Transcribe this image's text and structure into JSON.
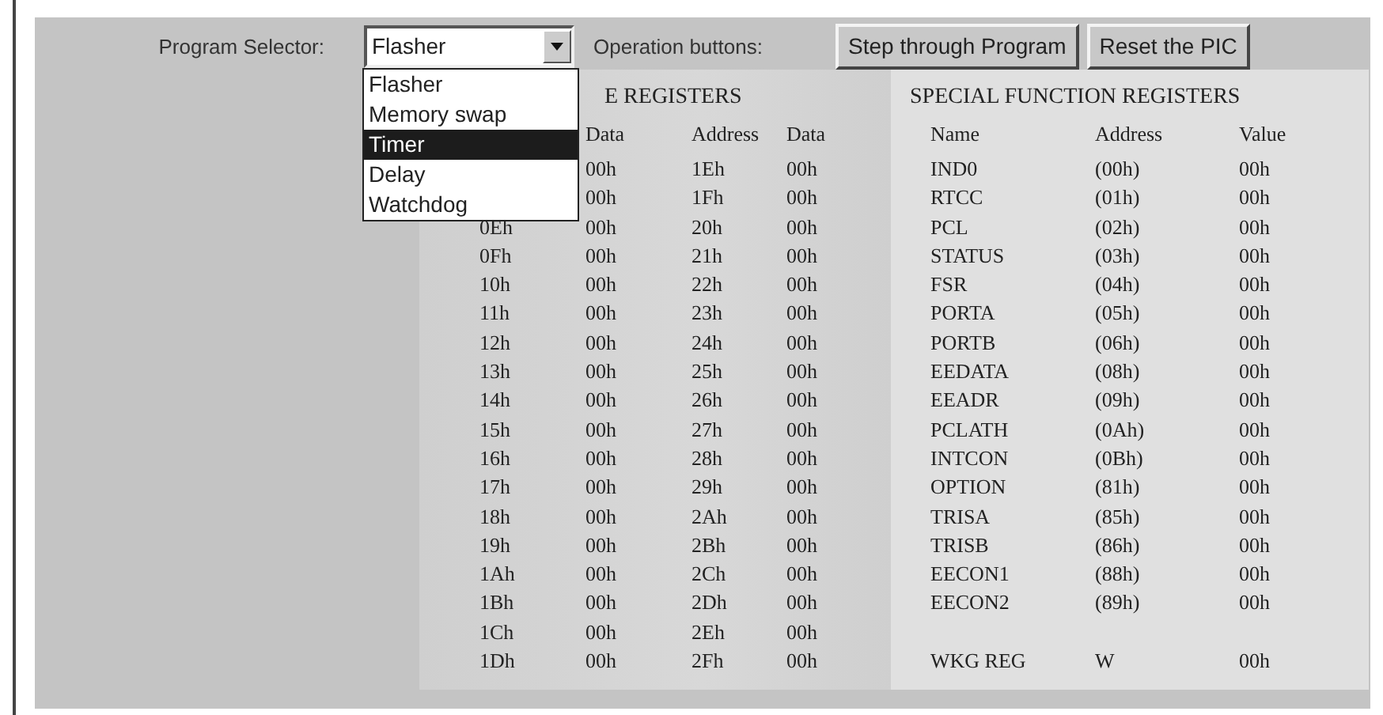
{
  "program_selector": {
    "label": "Program Selector:",
    "value": "Flasher",
    "expanded": true,
    "options": [
      {
        "label": "Flasher",
        "highlighted": false
      },
      {
        "label": "Memory swap",
        "highlighted": false
      },
      {
        "label": "Timer",
        "highlighted": true
      },
      {
        "label": "Delay",
        "highlighted": false
      },
      {
        "label": "Watchdog",
        "highlighted": false
      }
    ]
  },
  "operation_label": "Operation buttons:",
  "buttons": [
    "Step through Program",
    "Reset the PIC"
  ],
  "file_registers": {
    "title": "E REGISTERS",
    "columns": [
      "Data",
      "Address",
      "Data"
    ],
    "rows": [
      {
        "data": "00h",
        "address_2": "1Eh",
        "data_2": "00h"
      },
      {
        "data": "00h",
        "address_2": "1Fh",
        "data_2": "00h"
      },
      {
        "address": "0Eh",
        "data": "00h",
        "address_2": "20h",
        "data_2": "00h"
      },
      {
        "address": "0Fh",
        "data": "00h",
        "address_2": "21h",
        "data_2": "00h"
      },
      {
        "address": "10h",
        "data": "00h",
        "address_2": "22h",
        "data_2": "00h"
      },
      {
        "address": "11h",
        "data": "00h",
        "address_2": "23h",
        "data_2": "00h"
      },
      {
        "address": "12h",
        "data": "00h",
        "address_2": "24h",
        "data_2": "00h"
      },
      {
        "address": "13h",
        "data": "00h",
        "address_2": "25h",
        "data_2": "00h"
      },
      {
        "address": "14h",
        "data": "00h",
        "address_2": "26h",
        "data_2": "00h"
      },
      {
        "address": "15h",
        "data": "00h",
        "address_2": "27h",
        "data_2": "00h"
      },
      {
        "address": "16h",
        "data": "00h",
        "address_2": "28h",
        "data_2": "00h"
      },
      {
        "address": "17h",
        "data": "00h",
        "address_2": "29h",
        "data_2": "00h"
      },
      {
        "address": "18h",
        "data": "00h",
        "address_2": "2Ah",
        "data_2": "00h"
      },
      {
        "address": "19h",
        "data": "00h",
        "address_2": "2Bh",
        "data_2": "00h"
      },
      {
        "address": "1Ah",
        "data": "00h",
        "address_2": "2Ch",
        "data_2": "00h"
      },
      {
        "address": "1Bh",
        "data": "00h",
        "address_2": "2Dh",
        "data_2": "00h"
      },
      {
        "address": "1Ch",
        "data": "00h",
        "address_2": "2Eh",
        "data_2": "00h"
      },
      {
        "address": "1Dh",
        "data": "00h",
        "address_2": "2Fh",
        "data_2": "00h"
      }
    ]
  },
  "special_function_registers": {
    "title": "SPECIAL FUNCTION REGISTERS",
    "columns": [
      "Name",
      "Address",
      "Value"
    ],
    "rows": [
      {
        "name": "IND0",
        "address": "(00h)",
        "value": "00h"
      },
      {
        "name": "RTCC",
        "address": "(01h)",
        "value": "00h"
      },
      {
        "name": "PCL",
        "address": "(02h)",
        "value": "00h"
      },
      {
        "name": "STATUS",
        "address": "(03h)",
        "value": "00h"
      },
      {
        "name": "FSR",
        "address": "(04h)",
        "value": "00h"
      },
      {
        "name": "PORTA",
        "address": "(05h)",
        "value": "00h"
      },
      {
        "name": "PORTB",
        "address": "(06h)",
        "value": "00h"
      },
      {
        "name": "EEDATA",
        "address": "(08h)",
        "value": "00h"
      },
      {
        "name": "EEADR",
        "address": "(09h)",
        "value": "00h"
      },
      {
        "name": "PCLATH",
        "address": "(0Ah)",
        "value": "00h"
      },
      {
        "name": "INTCON",
        "address": "(0Bh)",
        "value": "00h"
      },
      {
        "name": "OPTION",
        "address": "(81h)",
        "value": "00h"
      },
      {
        "name": "TRISA",
        "address": "(85h)",
        "value": "00h"
      },
      {
        "name": "TRISB",
        "address": "(86h)",
        "value": "00h"
      },
      {
        "name": "EECON1",
        "address": "(88h)",
        "value": "00h"
      },
      {
        "name": "EECON2",
        "address": "(89h)",
        "value": "00h"
      }
    ],
    "working_register": {
      "name": "WKG REG",
      "address": "W",
      "value": "00h"
    }
  }
}
